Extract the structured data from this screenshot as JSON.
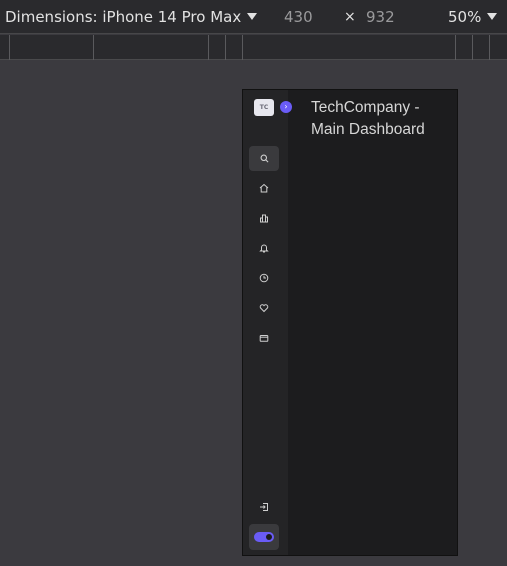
{
  "toolbar": {
    "device_label": "Dimensions: iPhone 14 Pro Max",
    "width_value": "430",
    "times_symbol": "×",
    "height_value": "932",
    "zoom_label": "50%"
  },
  "app": {
    "logo_text": "TC",
    "expand_symbol": "›",
    "title": "TechCompany - Main Dashboard",
    "nav_items": [
      "search-icon",
      "home-icon",
      "bar-chart-icon",
      "bell-icon",
      "clock-icon",
      "heart-icon",
      "wallet-icon"
    ],
    "footer_items": [
      "logout-icon",
      "theme-toggle"
    ],
    "accent_color": "#6a5cf6"
  }
}
